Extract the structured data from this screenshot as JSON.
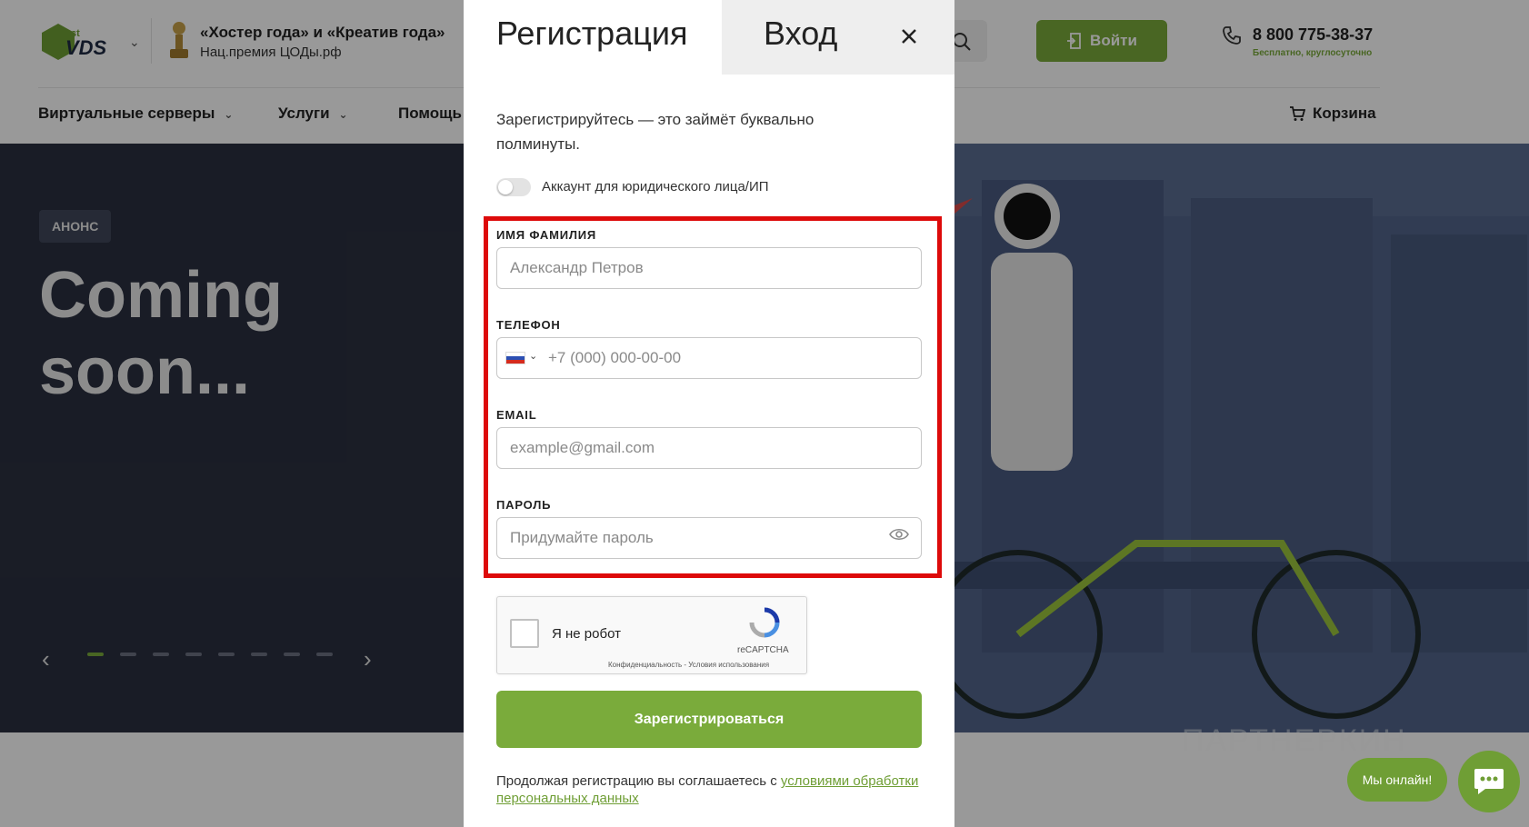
{
  "header": {
    "logo_text": "VDS",
    "logo_sup": "st",
    "award_title": "«Хостер года» и «Креатив года»",
    "award_sub": "Нац.премия ЦОДы.рф",
    "login_label": "Войти",
    "phone": "8 800 775-38-37",
    "phone_note": "Бесплатно, круглосуточно"
  },
  "nav": {
    "items": [
      {
        "label": "Виртуальные серверы"
      },
      {
        "label": "Услуги"
      },
      {
        "label": "Помощь"
      }
    ],
    "cart_label": "Корзина"
  },
  "hero": {
    "badge": "АНОНС",
    "title": "Coming soon...",
    "dots_count": 8,
    "active_dot": 1
  },
  "modal": {
    "tab_register": "Регистрация",
    "tab_login": "Вход",
    "intro": "Зарегистрируйтесь — это займёт буквально полминуты.",
    "toggle_label": "Аккаунт для юридического лица/ИП",
    "fields": {
      "name": {
        "label": "ИМЯ ФАМИЛИЯ",
        "placeholder": "Александр Петров"
      },
      "phone": {
        "label": "ТЕЛЕФОН",
        "placeholder": "+7 (000) 000-00-00"
      },
      "email": {
        "label": "EMAIL",
        "placeholder": "example@gmail.com"
      },
      "password": {
        "label": "ПАРОЛЬ",
        "placeholder": "Придумайте пароль"
      }
    },
    "captcha": {
      "text": "Я не робот",
      "brand": "reCAPTCHA",
      "links": "Конфиденциальность - Условия использования"
    },
    "submit_label": "Зарегистрироваться",
    "consent_text": "Продолжая регистрацию вы соглашаетесь с ",
    "consent_link": "условиями обработки персональных данных"
  },
  "widgets": {
    "watermark": "ПАРТНЕРКИН",
    "online_label": "Мы онлайн!"
  },
  "colors": {
    "accent": "#7aab3b",
    "hero_bg": "#2b3040",
    "highlight": "#dd0a0a"
  }
}
